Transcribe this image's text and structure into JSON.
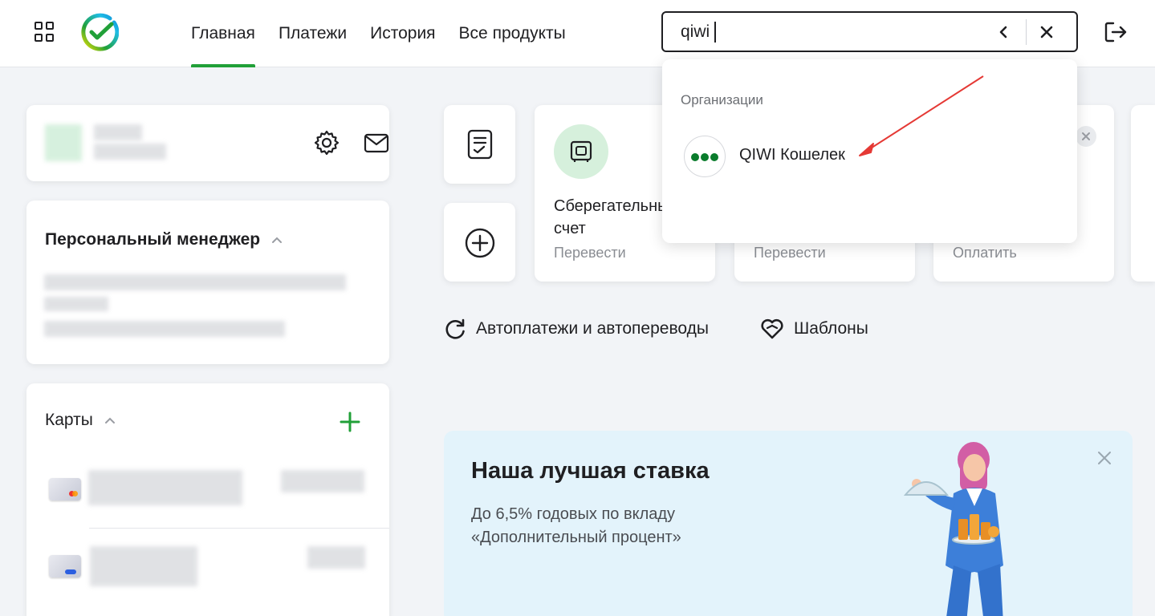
{
  "header": {
    "nav": [
      {
        "label": "Главная",
        "active": true
      },
      {
        "label": "Платежи",
        "active": false
      },
      {
        "label": "История",
        "active": false
      },
      {
        "label": "Все продукты",
        "active": false
      }
    ],
    "search_value": "qiwi"
  },
  "dropdown": {
    "section_title": "Организации",
    "items": [
      {
        "label": "QIWI Кошелек",
        "icon": "qiwi-logo"
      }
    ]
  },
  "sidebar": {
    "manager_title": "Персональный менеджер",
    "cards_title": "Карты"
  },
  "tiles": [
    {
      "title": "Сберегательный\nсчет",
      "subtitle": "Перевести"
    },
    {
      "title": "",
      "subtitle": "Перевести"
    },
    {
      "title": "",
      "subtitle": "Оплатить"
    }
  ],
  "links": {
    "autopay": "Автоплатежи и автопереводы",
    "templates": "Шаблоны"
  },
  "promo": {
    "title": "Наша лучшая ставка",
    "line1": "До 6,5% годовых по вкладу",
    "line2": "«Дополнительный процент»"
  },
  "colors": {
    "brand_green": "#21a038",
    "annotation_arrow": "#e53935",
    "promo_bg": "#e3f3fb"
  }
}
